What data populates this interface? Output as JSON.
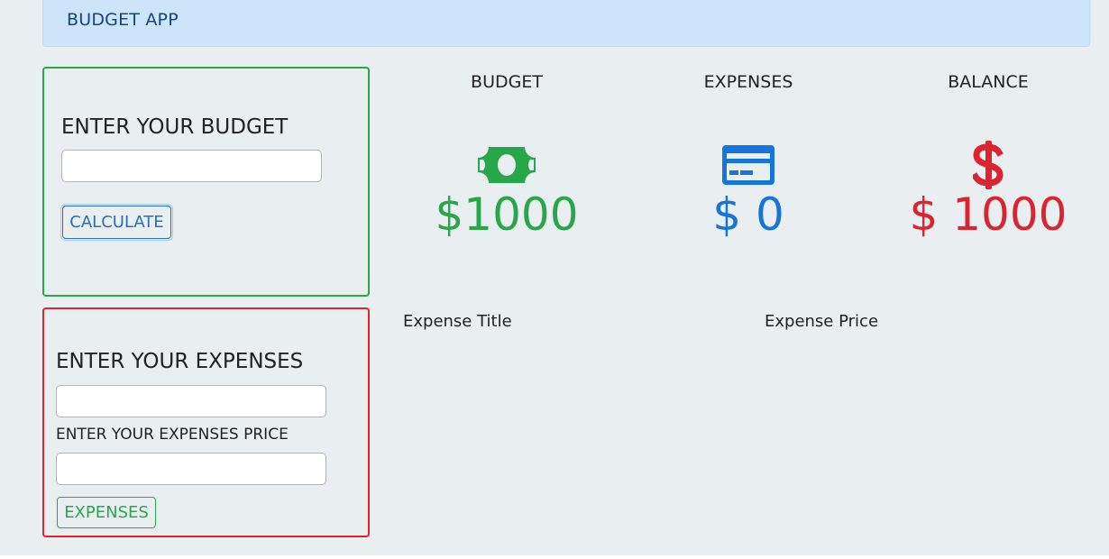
{
  "app": {
    "title": "BUDGET APP"
  },
  "budget_form": {
    "heading": "ENTER YOUR BUDGET",
    "input_value": "",
    "button_label": "CALCULATE"
  },
  "expense_form": {
    "heading": "ENTER YOUR EXPENSES",
    "title_input_value": "",
    "price_label": "ENTER YOUR EXPENSES PRICE",
    "price_input_value": "",
    "button_label": "EXPENSES"
  },
  "stats": {
    "budget": {
      "title": "BUDGET",
      "value": "$1000",
      "icon": "money-bill-icon",
      "color": "#27a74a"
    },
    "expenses": {
      "title": "EXPENSES",
      "value": "$ 0",
      "icon": "credit-card-icon",
      "color": "#1575d9"
    },
    "balance": {
      "title": "BALANCE",
      "value": "$ 1000",
      "icon": "dollar-sign-icon",
      "color": "#dc2330"
    }
  },
  "expense_list": {
    "col_title": "Expense Title",
    "col_price": "Expense Price",
    "items": []
  },
  "theme": {
    "header_bg": "#cce5fb",
    "page_bg": "#e9eef0"
  }
}
